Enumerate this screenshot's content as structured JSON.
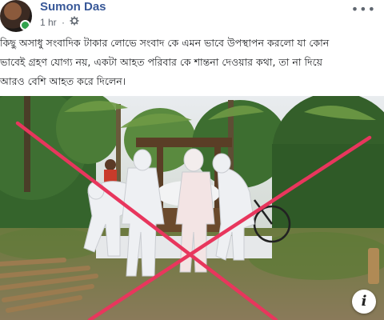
{
  "post": {
    "author": "Sumon Das",
    "time": "1 hr",
    "privacy_separator": "·",
    "privacy_icon": "gear-icon",
    "more_icon": "more-options-icon",
    "text_lines": [
      "কিছু অসাধু সংবাদিক টাকার লোভে সংবাদ কে এমন ভাবে উপস্থাপন করলো যা কোন",
      "ভাবেই গ্রহণ যোগ্য নয়, একটা আহত পরিবার কে শান্তনা দেওয়ার কথা, তা না দিয়ে",
      "আরও বেশি আহত করে দিলেন।"
    ]
  },
  "photo": {
    "info_label": "i",
    "cross_color": "#e8365d",
    "sky_color": "#cfd6c9",
    "suit_color": "#eef0f3"
  }
}
